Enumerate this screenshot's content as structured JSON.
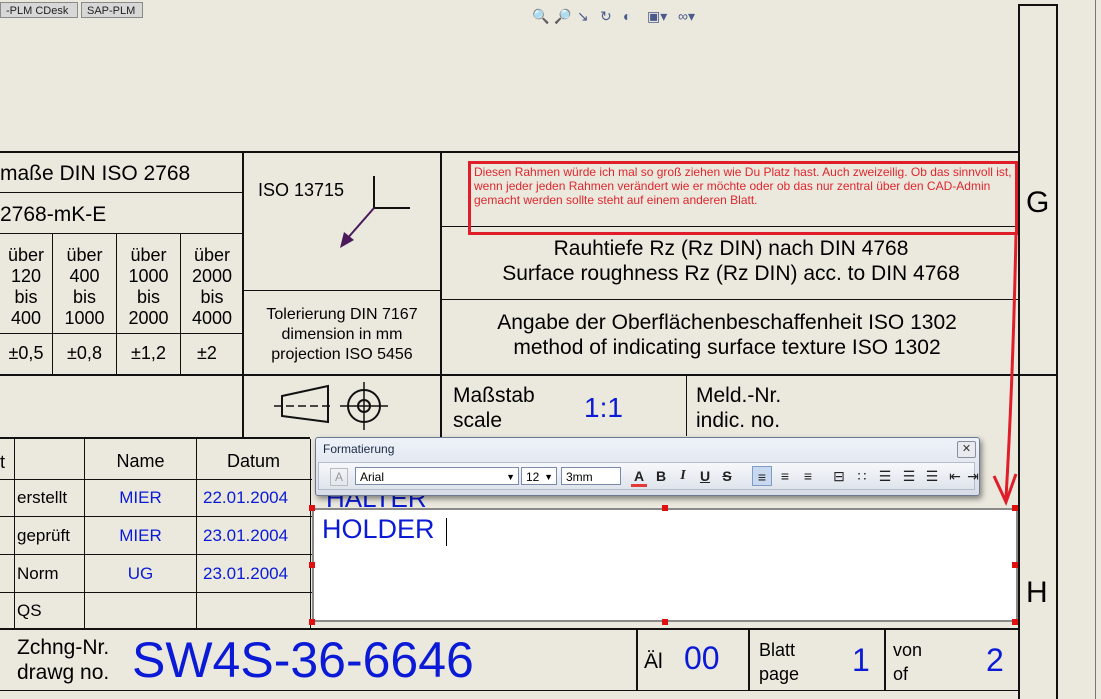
{
  "tabs": [
    {
      "label": "-PLM CDesk"
    },
    {
      "label": "SAP-PLM"
    }
  ],
  "toolbar_icons": [
    "zoom-in-icon",
    "zoom-area-icon",
    "pan-icon",
    "rotate-icon",
    "appearance-icon",
    "display-style-icon",
    "view-settings-icon"
  ],
  "general_tolerance": {
    "title": "maße DIN ISO 2768",
    "class": "2768-mK-E",
    "ranges": [
      {
        "label": "über\n120\nbis\n400",
        "value": "±0,5"
      },
      {
        "label": "über\n400\nbis\n1000",
        "value": "±0,8"
      },
      {
        "label": "über\n1000\nbis\n2000",
        "value": "±1,2"
      },
      {
        "label": "über\n2000\nbis\n4000",
        "value": "±2"
      }
    ]
  },
  "iso_symbol": {
    "label": "ISO 13715"
  },
  "tolerancing": {
    "line1": "Tolerierung DIN 7167",
    "line2": "dimension in mm",
    "line3": "projection ISO 5456"
  },
  "comment": {
    "text": "Diesen Rahmen würde ich mal so groß ziehen wie Du Platz hast. Auch zweizeilig. Ob das sinnvoll ist, wenn jeder jeden Rahmen verändert wie er möchte oder ob das nur zentral über den CAD-Admin gemacht werden sollte steht auf einem anderen Blatt."
  },
  "roughness": {
    "line1": "Rauhtiefe Rz (Rz DIN) nach DIN 4768",
    "line2": "Surface roughness Rz (Rz DIN) acc. to DIN 4768"
  },
  "surface": {
    "line1": "Angabe der Oberflächenbeschaffenheit ISO 1302",
    "line2": "method of indicating surface texture ISO 1302"
  },
  "scale": {
    "label1": "Maßstab",
    "label2": "scale",
    "value": "1:1"
  },
  "meld": {
    "label1": "Meld.-Nr.",
    "label2": "indic. no."
  },
  "approvals": {
    "col_name": "Name",
    "col_date": "Datum",
    "col_first": "t",
    "rows": [
      {
        "role": "erstellt",
        "name": "MIER",
        "date": "22.01.2004"
      },
      {
        "role": "geprüft",
        "name": "MIER",
        "date": "23.01.2004"
      },
      {
        "role": "Norm",
        "name": "UG",
        "date": "23.01.2004"
      },
      {
        "role": "QS",
        "name": "",
        "date": ""
      }
    ]
  },
  "title_field": {
    "hidden_text": "HALTER",
    "value": "HOLDER"
  },
  "drawing": {
    "label1": "Zchng-Nr.",
    "label2": "drawg no.",
    "number": "SW4S-36-6646"
  },
  "revision": {
    "label": "Äl",
    "value": "00"
  },
  "sheet": {
    "label1": "Blatt",
    "label2": "page",
    "value": "1"
  },
  "of": {
    "label1": "von",
    "label2": "of",
    "value": "2"
  },
  "zones": {
    "g": "G",
    "h": "H"
  },
  "format_toolbar": {
    "title": "Formatierung",
    "font": "Arial",
    "size": "12",
    "height": "3mm",
    "buttons": {
      "a": "A",
      "bold": "B",
      "italic": "I",
      "underline": "U",
      "strike": "S"
    }
  },
  "colors": {
    "accent_blue": "#0a1ad6",
    "annotation_red": "#e0262e"
  }
}
